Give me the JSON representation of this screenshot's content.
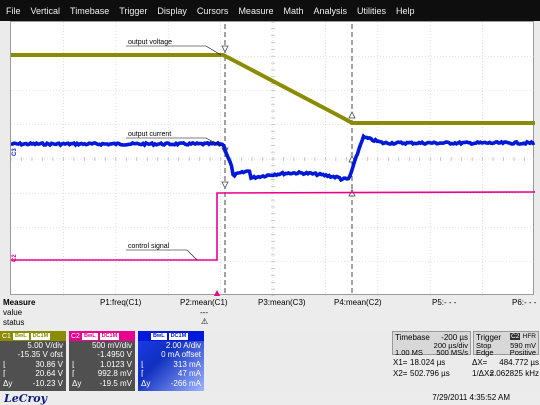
{
  "menu": [
    "File",
    "Vertical",
    "Timebase",
    "Trigger",
    "Display",
    "Cursors",
    "Measure",
    "Math",
    "Analysis",
    "Utilities",
    "Help"
  ],
  "annotations": {
    "output_voltage": "output voltage",
    "output_current": "output current",
    "control_signal": "control signal"
  },
  "channel_labels": {
    "c1": "C1",
    "c2": "C2",
    "c3": "C3"
  },
  "colors": {
    "c1": "#8b8b00",
    "c2": "#e8008e",
    "c3": "#0018d8"
  },
  "measure": {
    "title": "Measure",
    "row_labels": [
      "value",
      "status"
    ],
    "params": [
      {
        "name": "P1:freq(C1)",
        "value": "",
        "status": ""
      },
      {
        "name": "P2:mean(C1)",
        "value": "---",
        "status": "⚠"
      },
      {
        "name": "P3:mean(C3)",
        "value": "",
        "status": ""
      },
      {
        "name": "P4:mean(C2)",
        "value": "",
        "status": ""
      },
      {
        "name": "P5:- - -",
        "value": "",
        "status": ""
      },
      {
        "name": "P6:- - -",
        "value": "",
        "status": ""
      }
    ]
  },
  "channels": [
    {
      "id": "C1",
      "badges": [
        "BwL",
        "DC1M"
      ],
      "rows": [
        [
          "",
          "5.00 V/div"
        ],
        [
          "",
          "-15.35 V ofst"
        ],
        [
          "⌊",
          "30.86 V"
        ],
        [
          "⌈",
          "20.64 V"
        ],
        [
          "Δy",
          "-10.23 V"
        ]
      ]
    },
    {
      "id": "C2",
      "badges": [
        "BwL",
        "DC1M"
      ],
      "rows": [
        [
          "",
          "500 mV/div"
        ],
        [
          "",
          "-1.4950 V"
        ],
        [
          "⌊",
          "1.0123 V"
        ],
        [
          "⌈",
          "992.8 mV"
        ],
        [
          "Δy",
          "-19.5 mV"
        ]
      ]
    },
    {
      "id": "C3",
      "badges": [
        "BwL",
        "DC1M"
      ],
      "rows": [
        [
          "",
          "2.00 A/div"
        ],
        [
          "",
          "0 mA offset"
        ],
        [
          "⌊",
          "313 mA"
        ],
        [
          "⌈",
          "47 mA"
        ],
        [
          "Δy",
          "-266 mA"
        ]
      ]
    }
  ],
  "timebase": {
    "label": "Timebase",
    "delay": "-200 µs",
    "per_div": "200 µs/div",
    "samples": "1.00 MS",
    "rate": "500 MS/s"
  },
  "trigger": {
    "label": "Trigger",
    "source": "C2",
    "coupling": "HFR",
    "mode": "Stop",
    "level": "590 mV",
    "type": "Edge",
    "slope": "Positive"
  },
  "cursors": {
    "x1_label": "X1=",
    "x1": "18.024 µs",
    "dx_label": "ΔX=",
    "dx": "484.772 µs",
    "x2_label": "X2=",
    "x2": "502.796 µs",
    "inv_label": "1/ΔX=",
    "inv": "2.062825 kHz"
  },
  "brand": "LeCroy",
  "datetime": "7/29/2011 4:35:52 AM"
}
